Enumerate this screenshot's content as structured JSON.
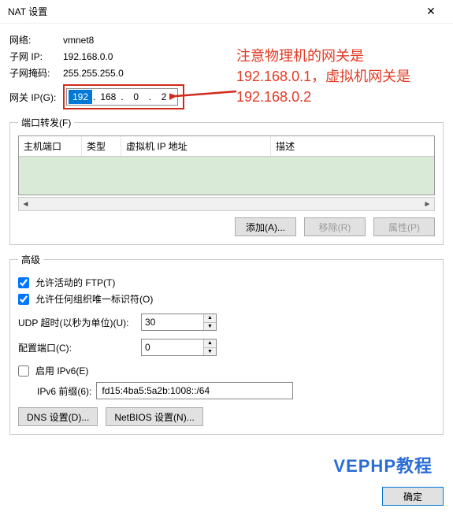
{
  "window": {
    "title": "NAT 设置",
    "close_icon": "✕"
  },
  "info": {
    "network_label": "网络:",
    "network_value": "vmnet8",
    "subnet_ip_label": "子网 IP:",
    "subnet_ip_value": "192.168.0.0",
    "subnet_mask_label": "子网掩码:",
    "subnet_mask_value": "255.255.255.0"
  },
  "gateway": {
    "label": "网关 IP(G):",
    "oct1": "192",
    "oct2": "168",
    "oct3": "0",
    "oct4": "2"
  },
  "port_forward": {
    "legend": "端口转发(F)",
    "cols": {
      "host_port": "主机端口",
      "type": "类型",
      "vm_ip": "虚拟机 IP 地址",
      "desc": "描述"
    },
    "buttons": {
      "add": "添加(A)...",
      "remove": "移除(R)",
      "properties": "属性(P)"
    }
  },
  "advanced": {
    "legend": "高级",
    "allow_active_ftp": "允许活动的 FTP(T)",
    "allow_oui": "允许任何组织唯一标识符(O)",
    "udp_timeout_label": "UDP 超时(以秒为单位)(U):",
    "udp_timeout_value": "30",
    "config_port_label": "配置端口(C):",
    "config_port_value": "0",
    "enable_ipv6": "启用 IPv6(E)",
    "ipv6_prefix_label": "IPv6 前缀(6):",
    "ipv6_prefix_value": "fd15:4ba5:5a2b:1008::/64",
    "dns_btn": "DNS 设置(D)...",
    "netbios_btn": "NetBIOS 设置(N)..."
  },
  "footer": {
    "ok": "确定"
  },
  "annotation": {
    "text": "注意物理机的网关是192.168.0.1，虚拟机网关是192.168.0.2"
  },
  "watermark": "VEPHP教程"
}
